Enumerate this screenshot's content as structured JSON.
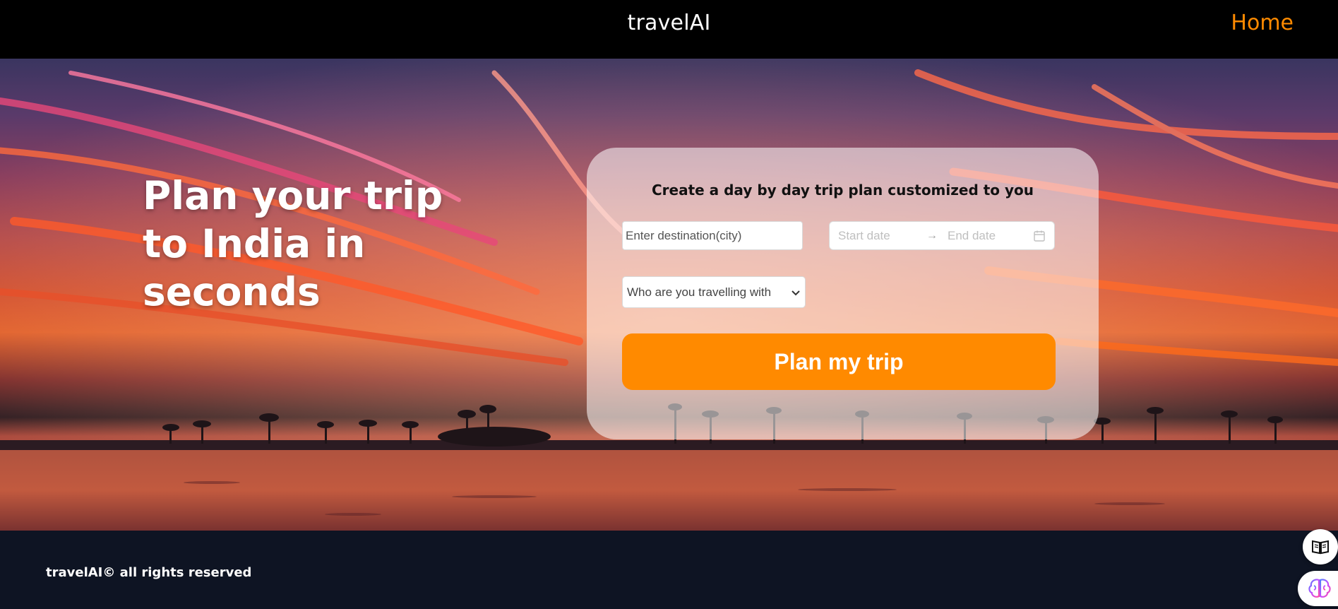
{
  "navbar": {
    "brand": "travelAI",
    "home_link": "Home"
  },
  "hero": {
    "headline": "Plan your trip to India in seconds"
  },
  "form": {
    "title": "Create a day by day trip plan customized to you",
    "destination": {
      "placeholder": "Enter destination(city)",
      "value": ""
    },
    "date_range": {
      "start_placeholder": "Start date",
      "end_placeholder": "End date",
      "separator_icon": "arrow-right-icon",
      "calendar_icon": "calendar-icon"
    },
    "companion_select": {
      "selected": "Who are you travelling with",
      "icon": "chevron-down-icon"
    },
    "submit_label": "Plan my trip"
  },
  "footer": {
    "copyright": "travelAI© all rights reserved"
  },
  "floating_buttons": [
    {
      "icon": "book-icon"
    },
    {
      "icon": "brain-icon"
    }
  ],
  "colors": {
    "accent": "#ff8a00",
    "navbar_bg": "#000000",
    "footer_bg": "#0e1423",
    "card_bg": "rgba(255,255,255,0.55)"
  }
}
